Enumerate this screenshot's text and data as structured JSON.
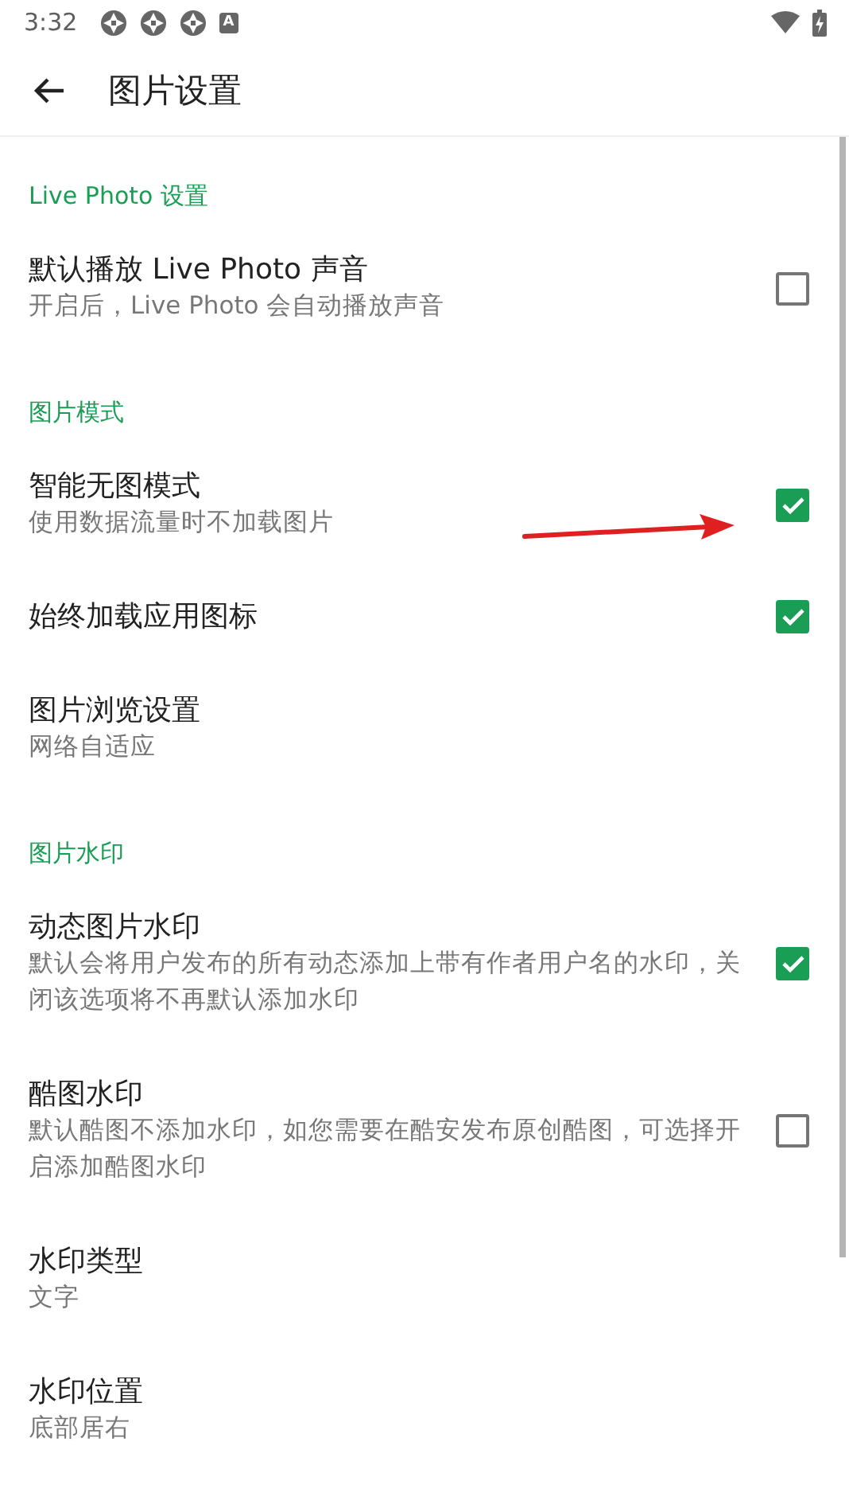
{
  "status_bar": {
    "time": "3:32",
    "badge": "A"
  },
  "app_bar": {
    "title": "图片设置"
  },
  "sections": [
    {
      "title": "Live Photo 设置",
      "items": [
        {
          "kind": "checkbox",
          "title": "默认播放 Live Photo 声音",
          "summary": "开启后，Live Photo 会自动播放声音",
          "checked": false
        }
      ]
    },
    {
      "title": "图片模式",
      "items": [
        {
          "kind": "checkbox",
          "title": "智能无图模式",
          "summary": "使用数据流量时不加载图片",
          "checked": true
        },
        {
          "kind": "checkbox",
          "title": "始终加载应用图标",
          "checked": true
        },
        {
          "kind": "text",
          "title": "图片浏览设置",
          "summary": "网络自适应"
        }
      ]
    },
    {
      "title": "图片水印",
      "items": [
        {
          "kind": "checkbox",
          "title": "动态图片水印",
          "summary": "默认会将用户发布的所有动态添加上带有作者用户名的水印，关闭该选项将不再默认添加水印",
          "checked": true
        },
        {
          "kind": "checkbox",
          "title": "酷图水印",
          "summary": "默认酷图不添加水印，如您需要在酷安发布原创酷图，可选择开启添加酷图水印",
          "checked": false
        },
        {
          "kind": "text",
          "title": "水印类型",
          "summary": "文字"
        },
        {
          "kind": "text",
          "title": "水印位置",
          "summary": "底部居右"
        }
      ]
    }
  ]
}
